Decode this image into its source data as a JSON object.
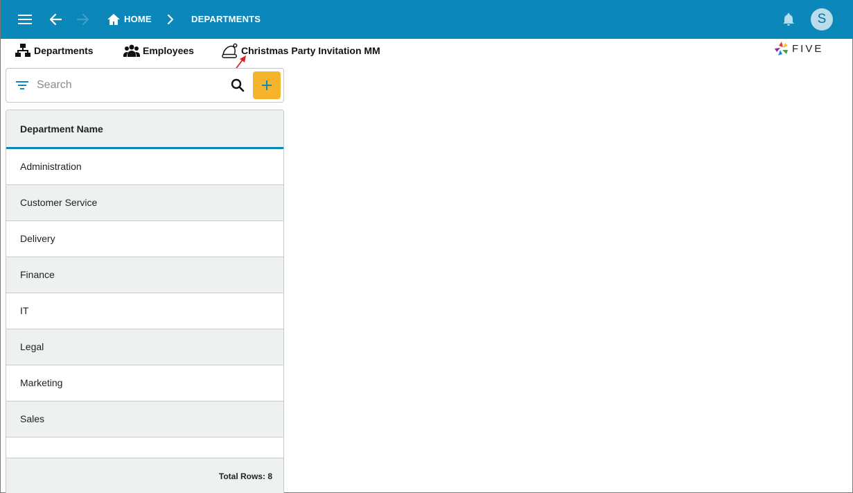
{
  "appbar": {
    "breadcrumb_home": "HOME",
    "breadcrumb_current": "DEPARTMENTS",
    "avatar_initial": "S",
    "color": "#0c87b9"
  },
  "menu": {
    "items": [
      {
        "label": "Departments",
        "icon": "sitemap-icon"
      },
      {
        "label": "Employees",
        "icon": "people-group-icon"
      },
      {
        "label": "Christmas Party Invitation MM",
        "icon": "santa-hat-icon"
      }
    ]
  },
  "logo": {
    "text": "FIVE"
  },
  "search": {
    "placeholder": "Search",
    "value": ""
  },
  "add_button": {
    "color": "#f6b42c"
  },
  "table": {
    "header": "Department Name",
    "rows": [
      "Administration",
      "Customer Service",
      "Delivery",
      "Finance",
      "IT",
      "Legal",
      "Marketing",
      "Sales"
    ],
    "footer": "Total Rows: 8"
  }
}
